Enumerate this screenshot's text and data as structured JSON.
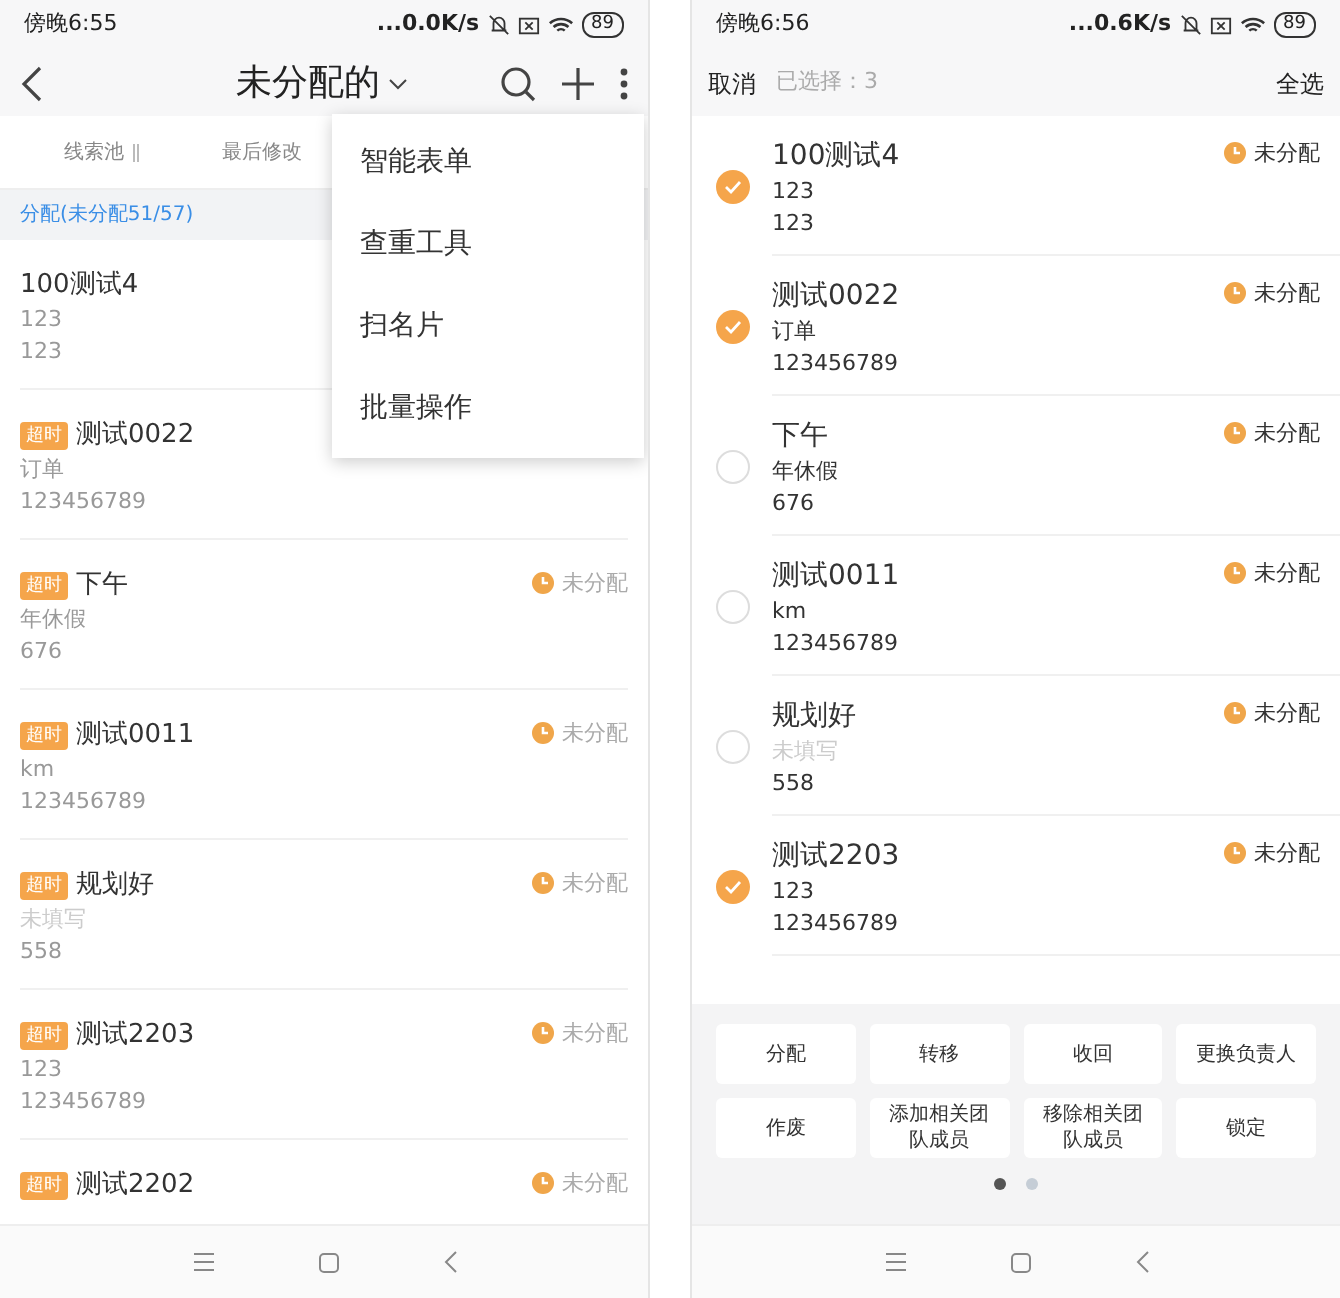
{
  "left_screen": {
    "status_bar": {
      "time": "傍晚6:55",
      "speed": "...0.0K/s",
      "battery": "89"
    },
    "nav": {
      "title": "未分配的"
    },
    "sort_bar": [
      {
        "label": "线索池",
        "sortable": true
      },
      {
        "label": "最后修改",
        "sortable": false
      }
    ],
    "section_header": "分配(未分配51/57)",
    "items": [
      {
        "title": "100测试4",
        "overdue": false,
        "lines": [
          {
            "text": "123",
            "dimmed": false
          },
          {
            "text": "123",
            "dimmed": false
          }
        ]
      },
      {
        "title": "测试0022",
        "overdue": true,
        "badge": "超时",
        "lines": [
          {
            "text": "订单",
            "dimmed": false
          },
          {
            "text": "123456789",
            "dimmed": false
          }
        ]
      },
      {
        "title": "下午",
        "overdue": true,
        "badge": "超时",
        "status": "未分配",
        "lines": [
          {
            "text": "年休假",
            "dimmed": false
          },
          {
            "text": "676",
            "dimmed": false
          }
        ]
      },
      {
        "title": "测试0011",
        "overdue": true,
        "badge": "超时",
        "status": "未分配",
        "lines": [
          {
            "text": "km",
            "dimmed": false
          },
          {
            "text": "123456789",
            "dimmed": false
          }
        ]
      },
      {
        "title": "规划好",
        "overdue": true,
        "badge": "超时",
        "status": "未分配",
        "lines": [
          {
            "text": "未填写",
            "dimmed": true
          },
          {
            "text": "558",
            "dimmed": false
          }
        ]
      },
      {
        "title": "测试2203",
        "overdue": true,
        "badge": "超时",
        "status": "未分配",
        "lines": [
          {
            "text": "123",
            "dimmed": false
          },
          {
            "text": "123456789",
            "dimmed": false
          }
        ]
      },
      {
        "title": "测试2202",
        "overdue": true,
        "badge": "超时",
        "status": "未分配"
      }
    ],
    "menu": [
      "智能表单",
      "查重工具",
      "扫名片",
      "批量操作"
    ]
  },
  "right_screen": {
    "status_bar": {
      "time": "傍晚6:56",
      "speed": "...0.6K/s",
      "battery": "89"
    },
    "header": {
      "cancel": "取消",
      "selected_count": "已选择：3",
      "select_all": "全选"
    },
    "items": [
      {
        "title": "100测试4",
        "selected": true,
        "status": "未分配",
        "lines": [
          {
            "text": "123",
            "dimmed": false
          },
          {
            "text": "123",
            "dimmed": false
          }
        ]
      },
      {
        "title": "测试0022",
        "selected": true,
        "status": "未分配",
        "lines": [
          {
            "text": "订单",
            "dimmed": false
          },
          {
            "text": "123456789",
            "dimmed": false
          }
        ]
      },
      {
        "title": "下午",
        "selected": false,
        "status": "未分配",
        "lines": [
          {
            "text": "年休假",
            "dimmed": false
          },
          {
            "text": "676",
            "dimmed": false
          }
        ]
      },
      {
        "title": "测试0011",
        "selected": false,
        "status": "未分配",
        "lines": [
          {
            "text": "km",
            "dimmed": false
          },
          {
            "text": "123456789",
            "dimmed": false
          }
        ]
      },
      {
        "title": "规划好",
        "selected": false,
        "status": "未分配",
        "lines": [
          {
            "text": "未填写",
            "dimmed": true
          },
          {
            "text": "558",
            "dimmed": false
          }
        ]
      },
      {
        "title": "测试2203",
        "selected": true,
        "status": "未分配",
        "lines": [
          {
            "text": "123",
            "dimmed": false
          },
          {
            "text": "123456789",
            "dimmed": false
          }
        ]
      }
    ],
    "actions": [
      {
        "label": "分配"
      },
      {
        "label": "转移"
      },
      {
        "label": "收回"
      },
      {
        "label": "更换负责人"
      },
      {
        "label": "作废"
      },
      {
        "label": "添加相关团队成员"
      },
      {
        "label": "移除相关团队成员"
      },
      {
        "label": "锁定"
      }
    ],
    "pages": [
      {
        "selected": true
      },
      {
        "selected": false
      }
    ]
  }
}
